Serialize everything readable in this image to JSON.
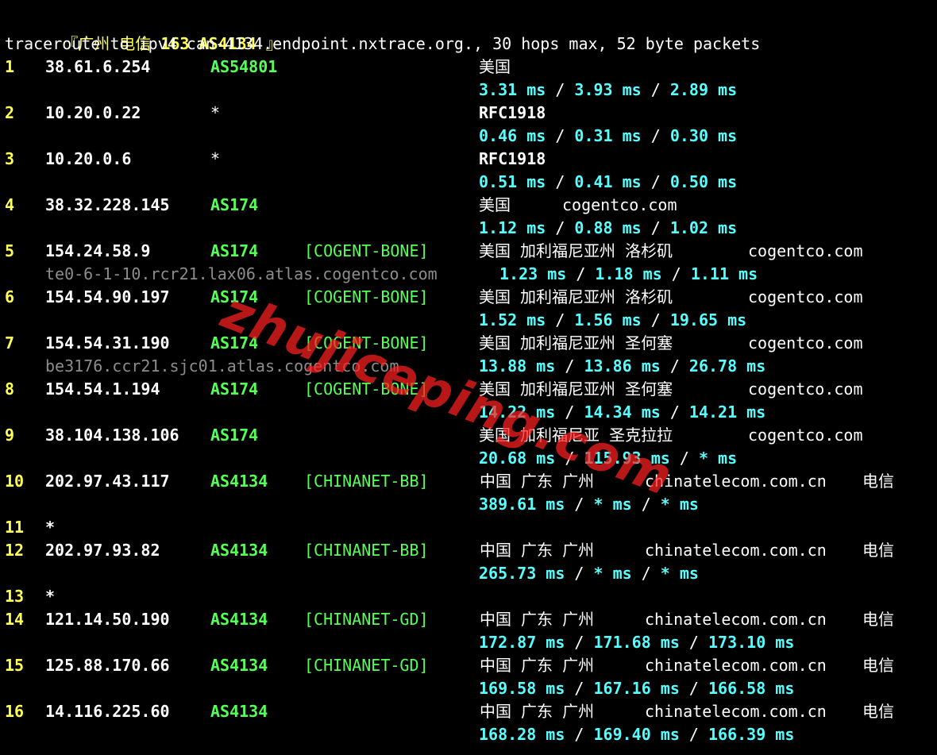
{
  "header": {
    "open_bracket": "『",
    "location": "广州 电信",
    "isp": "163 AS4134",
    "close_bracket": "』",
    "command": "traceroute to ipv4.can-4134.endpoint.nxtrace.org., 30 hops max, 52 byte packets"
  },
  "hops": [
    {
      "num": "1",
      "ip": "38.61.6.254",
      "asn": "AS54801",
      "tag": "",
      "geo": "美国",
      "host": "",
      "rtt": [
        "3.31 ms",
        "3.93 ms",
        "2.89 ms"
      ],
      "hostname": ""
    },
    {
      "num": "2",
      "ip": "10.20.0.22",
      "asn": "*",
      "tag": "",
      "geo": "RFC1918",
      "host": "",
      "rtt": [
        "0.46 ms",
        "0.31 ms",
        "0.30 ms"
      ],
      "hostname": ""
    },
    {
      "num": "3",
      "ip": "10.20.0.6",
      "asn": "*",
      "tag": "",
      "geo": "RFC1918",
      "host": "",
      "rtt": [
        "0.51 ms",
        "0.41 ms",
        "0.50 ms"
      ],
      "hostname": ""
    },
    {
      "num": "4",
      "ip": "38.32.228.145",
      "asn": "AS174",
      "tag": "",
      "geo": "美国",
      "host": "cogentco.com",
      "rtt": [
        "1.12 ms",
        "0.88 ms",
        "1.02 ms"
      ],
      "hostname": ""
    },
    {
      "num": "5",
      "ip": "154.24.58.9",
      "asn": "AS174",
      "tag": "[COGENT-BONE]",
      "geo": "美国 加利福尼亚州 洛杉矶",
      "host": "cogentco.com",
      "rtt": [
        "1.23 ms",
        "1.18 ms",
        "1.11 ms"
      ],
      "hostname": "te0-6-1-10.rcr21.lax06.atlas.cogentco.com"
    },
    {
      "num": "6",
      "ip": "154.54.90.197",
      "asn": "AS174",
      "tag": "[COGENT-BONE]",
      "geo": "美国 加利福尼亚州 洛杉矶",
      "host": "cogentco.com",
      "rtt": [
        "1.52 ms",
        "1.56 ms",
        "19.65 ms"
      ],
      "hostname": ""
    },
    {
      "num": "7",
      "ip": "154.54.31.190",
      "asn": "AS174",
      "tag": "[COGENT-BONE]",
      "geo": "美国 加利福尼亚州 圣何塞",
      "host": "cogentco.com",
      "rtt": [
        "13.88 ms",
        "13.86 ms",
        "26.78 ms"
      ],
      "hostname": "be3176.ccr21.sjc01.atlas.cogentco.com"
    },
    {
      "num": "8",
      "ip": "154.54.1.194",
      "asn": "AS174",
      "tag": "[COGENT-BONE]",
      "geo": "美国 加利福尼亚州 圣何塞",
      "host": "cogentco.com",
      "rtt": [
        "14.22 ms",
        "14.34 ms",
        "14.21 ms"
      ],
      "hostname": ""
    },
    {
      "num": "9",
      "ip": "38.104.138.106",
      "asn": "AS174",
      "tag": "",
      "geo": "美国 加利福尼亚 圣克拉拉",
      "host": "cogentco.com",
      "rtt": [
        "20.68 ms",
        "115.93 ms",
        "* ms"
      ],
      "hostname": ""
    },
    {
      "num": "10",
      "ip": "202.97.43.117",
      "asn": "AS4134",
      "tag": "[CHINANET-BB]",
      "geo": "中国 广东 广州",
      "host": "chinatelecom.com.cn",
      "carrier": "电信",
      "rtt": [
        "389.61 ms",
        "* ms",
        "* ms"
      ],
      "hostname": ""
    },
    {
      "num": "11",
      "star": "*"
    },
    {
      "num": "12",
      "ip": "202.97.93.82",
      "asn": "AS4134",
      "tag": "[CHINANET-BB]",
      "geo": "中国 广东 广州",
      "host": "chinatelecom.com.cn",
      "carrier": "电信",
      "rtt": [
        "265.73 ms",
        "* ms",
        "* ms"
      ],
      "hostname": ""
    },
    {
      "num": "13",
      "star": "*"
    },
    {
      "num": "14",
      "ip": "121.14.50.190",
      "asn": "AS4134",
      "tag": "[CHINANET-GD]",
      "geo": "中国 广东 广州",
      "host": "chinatelecom.com.cn",
      "carrier": "电信",
      "rtt": [
        "172.87 ms",
        "171.68 ms",
        "173.10 ms"
      ],
      "hostname": ""
    },
    {
      "num": "15",
      "ip": "125.88.170.66",
      "asn": "AS4134",
      "tag": "[CHINANET-GD]",
      "geo": "中国 广东 广州",
      "host": "chinatelecom.com.cn",
      "carrier": "电信",
      "rtt": [
        "169.58 ms",
        "167.16 ms",
        "166.58 ms"
      ],
      "hostname": ""
    },
    {
      "num": "16",
      "ip": "14.116.225.60",
      "asn": "AS4134",
      "tag": "",
      "geo": "中国 广东 广州",
      "host": "chinatelecom.com.cn",
      "carrier": "电信",
      "rtt": [
        "168.28 ms",
        "169.40 ms",
        "166.39 ms"
      ],
      "hostname": ""
    }
  ],
  "rtt_separator": " / ",
  "watermark": "zhujiceping.com",
  "colors": {
    "background": "#000000",
    "hop_number": "#ffff55",
    "asn": "#55ff55",
    "rtt": "#55ffff",
    "hostname": "#8c8c8c",
    "watermark": "#ff2020"
  }
}
